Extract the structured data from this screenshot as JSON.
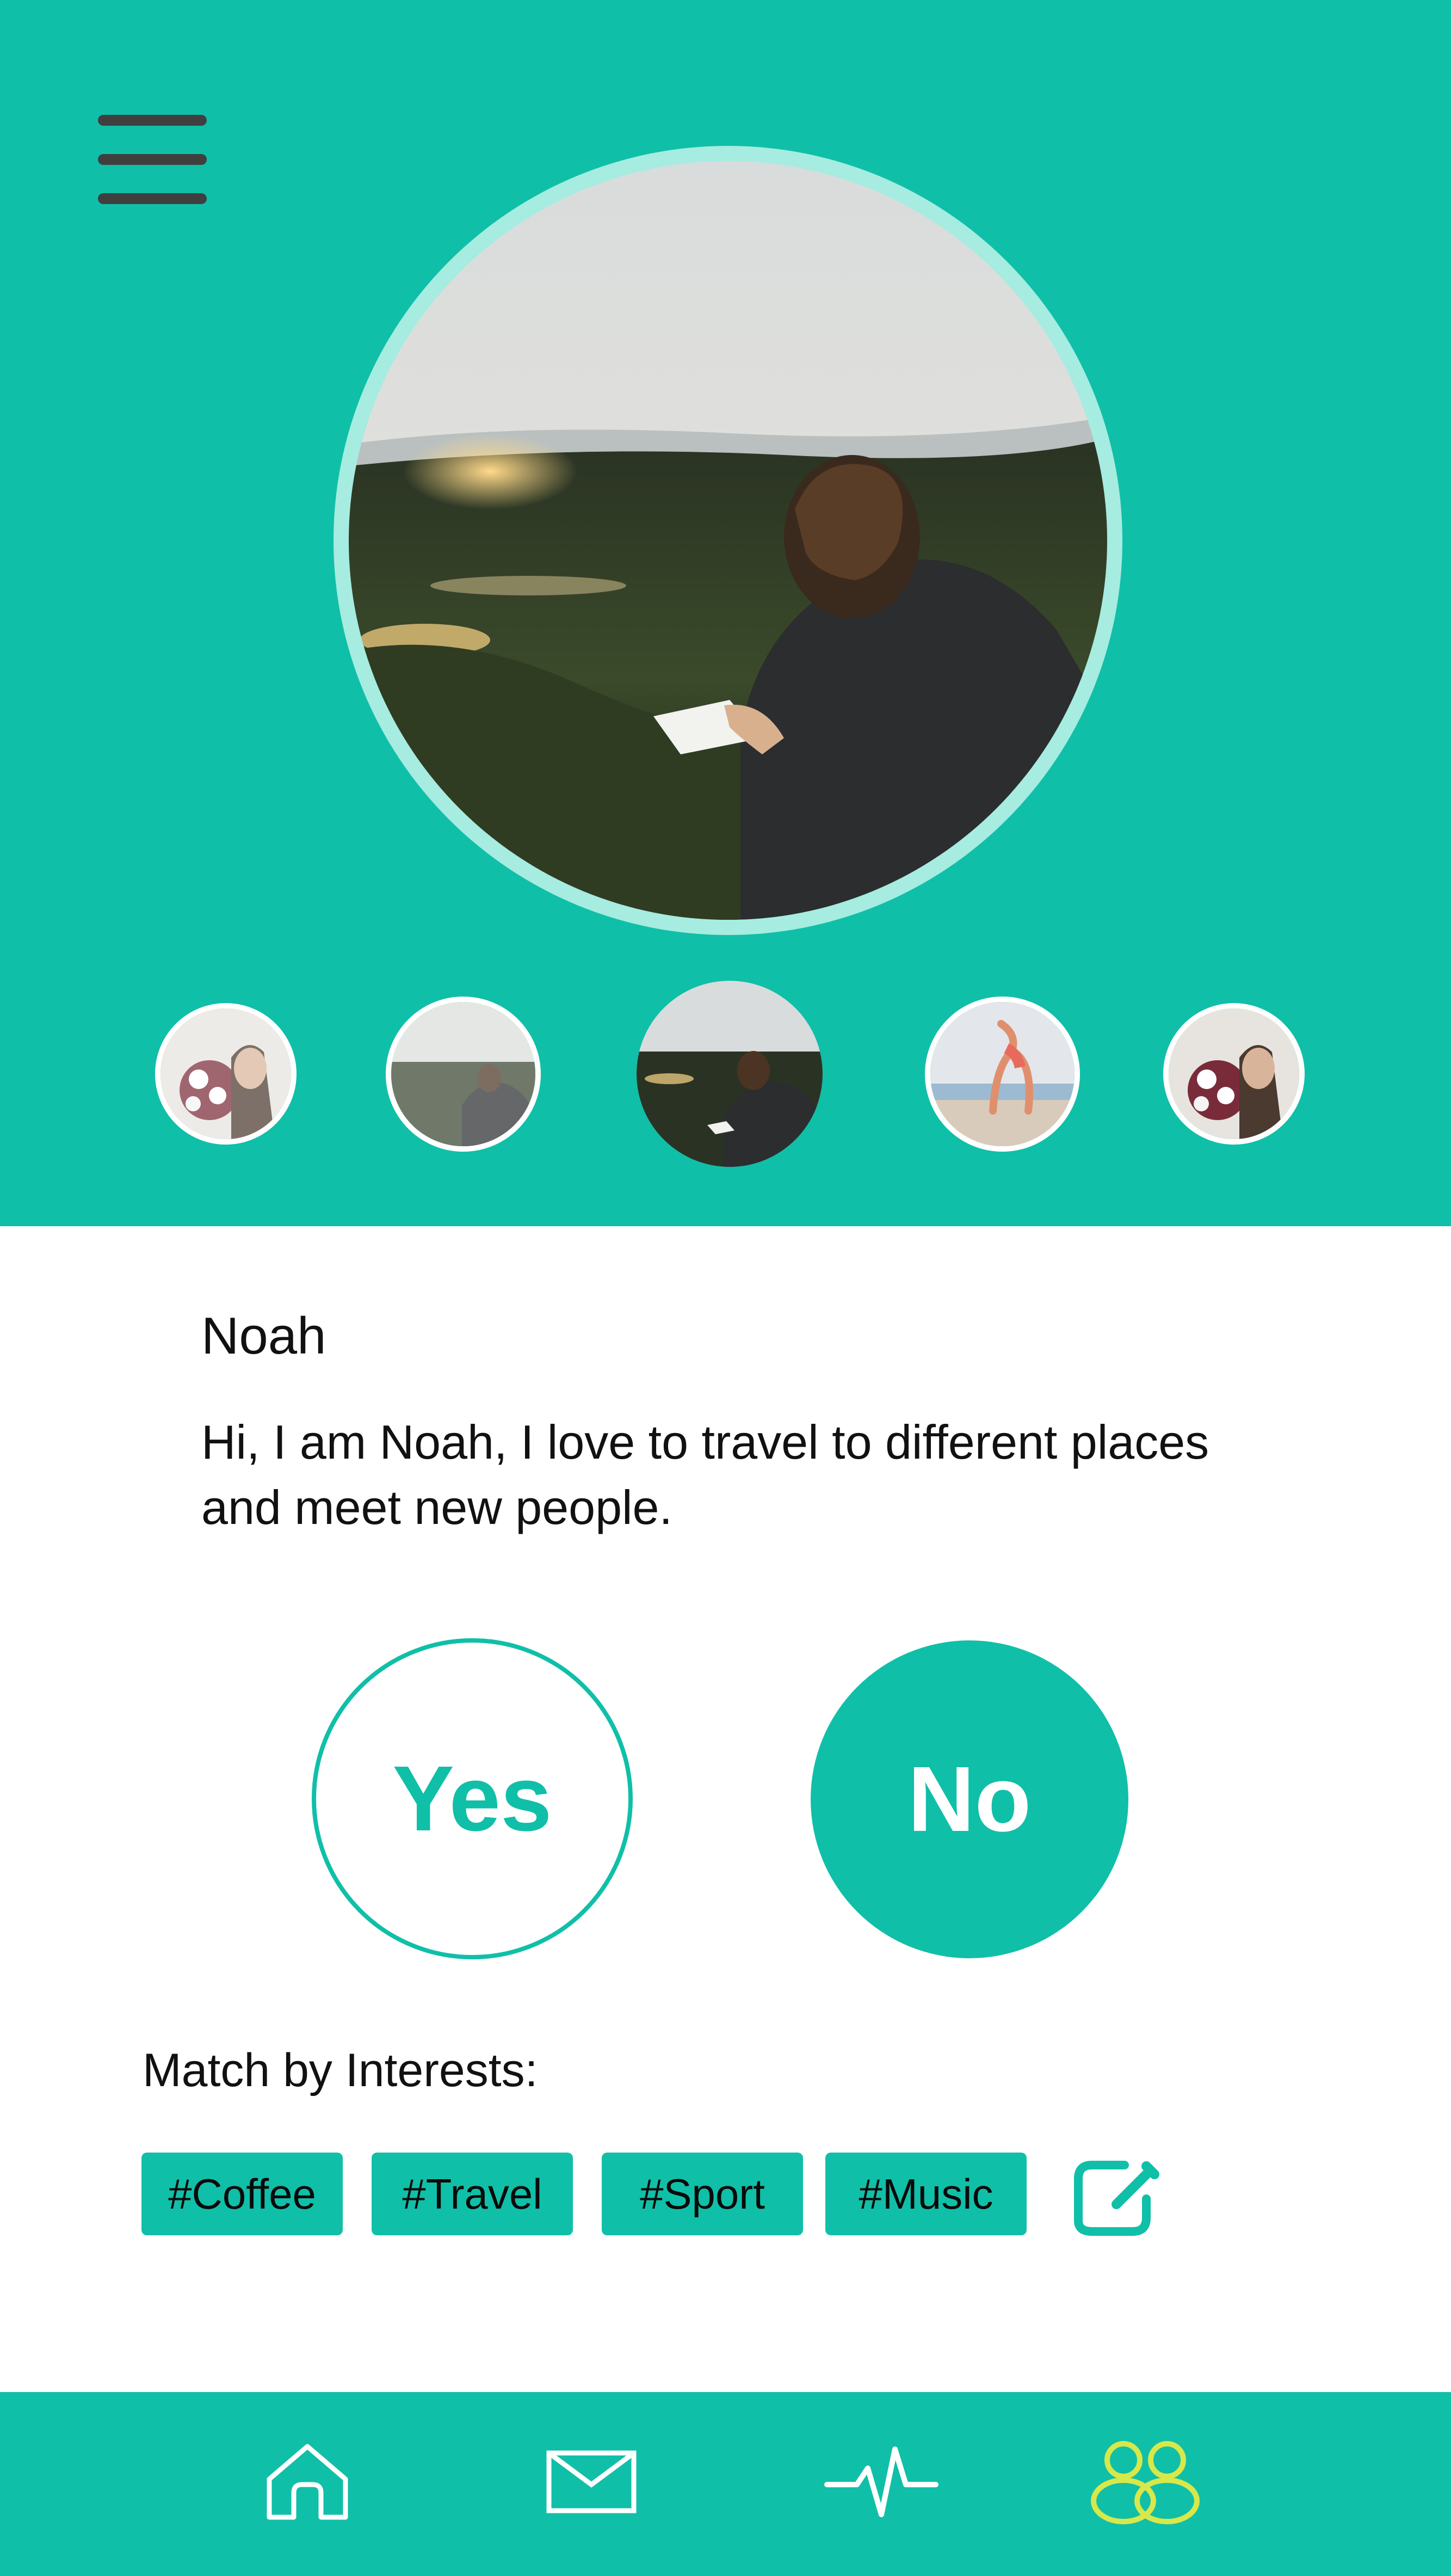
{
  "colors": {
    "teal": "#10bfa8",
    "ring": "#a6ece0",
    "menu": "#3f3f3f",
    "text": "#111111",
    "active_nav": "#d7e84a"
  },
  "header": {
    "menu_icon": "hamburger-menu-icon"
  },
  "photos": {
    "main": "man reading in field at sunset",
    "thumbnails": [
      "woman with flowers",
      "man reading in field",
      "man reading in field (selected)",
      "woman doing yoga on beach",
      "woman with flowers"
    ]
  },
  "profile": {
    "name": "Noah",
    "bio_line1": "Hi, I am Noah, I love to travel to different places",
    "bio_line2": "and meet new people."
  },
  "actions": {
    "yes_label": "Yes",
    "no_label": "No"
  },
  "interests": {
    "label": "Match by Interests:",
    "tags": [
      "#Coffee",
      "#Travel",
      "#Sport",
      "#Music"
    ],
    "edit_icon": "edit-icon"
  },
  "nav": {
    "items": [
      "home-icon",
      "mail-icon",
      "activity-icon",
      "people-icon"
    ],
    "active": "people-icon"
  }
}
